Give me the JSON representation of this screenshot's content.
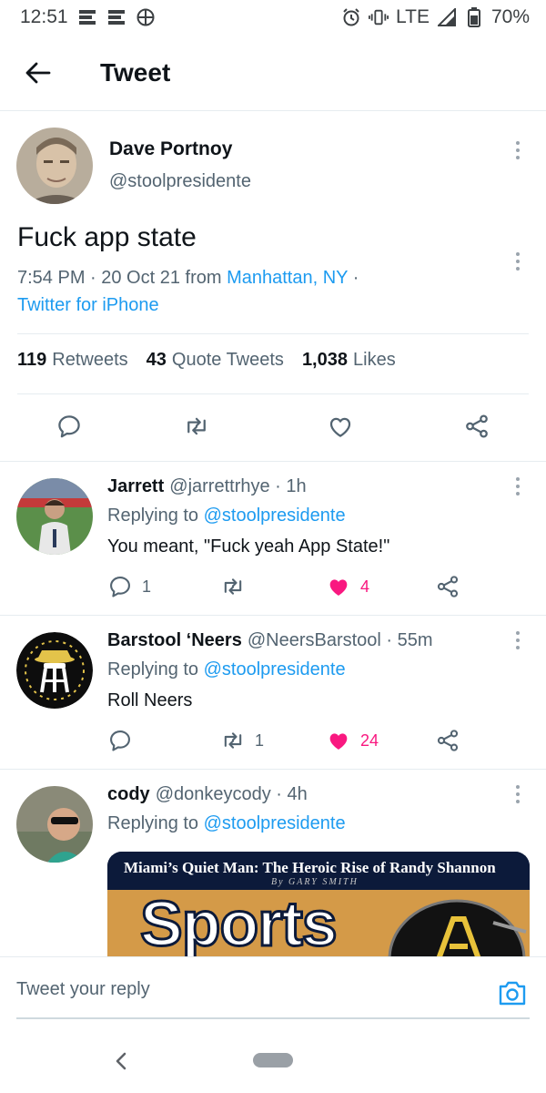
{
  "status_bar": {
    "time": "12:51",
    "network": "LTE",
    "battery": "70%"
  },
  "header": {
    "title": "Tweet"
  },
  "main_tweet": {
    "name": "Dave Portnoy",
    "handle": "@stoolpresidente",
    "text": "Fuck app state",
    "time_date": "7:54 PM · 20 Oct 21 from ",
    "location": "Manhattan, NY",
    "separator": " ·",
    "client": "Twitter for iPhone",
    "retweets": "119",
    "retweets_label": "Retweets",
    "quotes": "43",
    "quotes_label": "Quote Tweets",
    "likes": "1,038",
    "likes_label": "Likes"
  },
  "replies": [
    {
      "name": "Jarrett",
      "handle_time": "@jarrettrhye · 1h",
      "replying_prefix": "Replying to ",
      "replying_to": "@stoolpresidente",
      "text": "You meant, \"Fuck yeah App State!\"",
      "reply_count": "1",
      "retweet_count": "",
      "like_count": "4"
    },
    {
      "name": "Barstool ‘Neers",
      "handle_time": "@NeersBarstool · 55m",
      "replying_prefix": "Replying to ",
      "replying_to": "@stoolpresidente",
      "text": "Roll Neers",
      "reply_count": "",
      "retweet_count": "1",
      "like_count": "24"
    },
    {
      "name": "cody",
      "handle_time": "@donkeycody · 4h",
      "replying_prefix": "Replying to ",
      "replying_to": "@stoolpresidente",
      "media_headline": "Miami’s Quiet Man: The Heroic Rise of Randy Shannon",
      "media_byline": "By GARY SMITH",
      "media_masthead": "Sports"
    }
  ],
  "reply_bar": {
    "placeholder": "Tweet your reply"
  },
  "colors": {
    "accent": "#1d9bf0",
    "like": "#f91880",
    "text": "#0f1419",
    "muted": "#536471"
  },
  "icons": [
    "alarm-icon",
    "vibrate-icon",
    "signal-icon",
    "battery-icon",
    "back-arrow-icon",
    "more-icon",
    "reply-icon",
    "retweet-icon",
    "like-icon",
    "share-icon",
    "camera-icon"
  ]
}
